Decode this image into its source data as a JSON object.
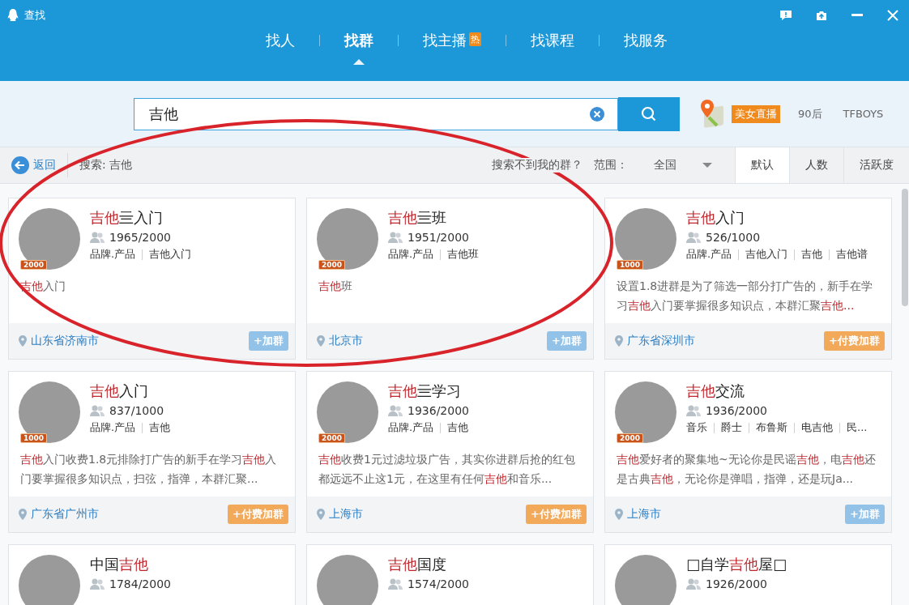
{
  "window": {
    "title": "查找"
  },
  "nav_tabs": [
    {
      "label": "找人",
      "selected": false
    },
    {
      "label": "找群",
      "selected": true
    },
    {
      "label": "找主播",
      "selected": false,
      "badge": "热"
    },
    {
      "label": "找课程",
      "selected": false
    },
    {
      "label": "找服务",
      "selected": false
    }
  ],
  "search": {
    "value": "吉他"
  },
  "hot_tags": [
    {
      "label": "美女直播",
      "kind": "highlight"
    },
    {
      "label": "90后",
      "kind": "plain"
    },
    {
      "label": "TFBOYS",
      "kind": "plain"
    }
  ],
  "filter_bar": {
    "back": "返回",
    "query": "搜索: 吉他",
    "help": "搜索不到我的群？",
    "range_label": "范围：",
    "range_value": "全国"
  },
  "sort_tabs": [
    {
      "label": "默认",
      "selected": true
    },
    {
      "label": "人数",
      "selected": false
    },
    {
      "label": "活跃度",
      "selected": false
    }
  ],
  "groups": [
    {
      "name": [
        {
          "text": "吉他",
          "highlight": true
        },
        {
          "text": "亖入门",
          "highlight": false
        }
      ],
      "tier": "2000",
      "members": "1965/2000",
      "tags": [
        "品牌.产品",
        "吉他入门"
      ],
      "description": [
        {
          "text": "吉他",
          "highlight": true
        },
        {
          "text": "入门",
          "highlight": false
        }
      ],
      "location": "山东省济南市",
      "button": {
        "label": "+加群",
        "kind": "free"
      }
    },
    {
      "name": [
        {
          "text": "吉他",
          "highlight": true
        },
        {
          "text": "亖班",
          "highlight": false
        }
      ],
      "tier": "2000",
      "members": "1951/2000",
      "tags": [
        "品牌.产品",
        "吉他班"
      ],
      "description": [
        {
          "text": "吉他",
          "highlight": true
        },
        {
          "text": "班",
          "highlight": false
        }
      ],
      "location": "北京市",
      "button": {
        "label": "+加群",
        "kind": "free"
      }
    },
    {
      "name": [
        {
          "text": "吉他",
          "highlight": true
        },
        {
          "text": "入门",
          "highlight": false
        }
      ],
      "tier": "1000",
      "members": "526/1000",
      "tags": [
        "品牌.产品",
        "吉他入门",
        "吉他",
        "吉他谱"
      ],
      "description": [
        {
          "text": "设置1.8进群是为了筛选一部分打广告的，新手在学习",
          "highlight": false
        },
        {
          "text": "吉他",
          "highlight": true
        },
        {
          "text": "入门要掌握很多知识点，本群汇聚",
          "highlight": false
        },
        {
          "text": "吉他...",
          "highlight": true
        }
      ],
      "location": "广东省深圳市",
      "button": {
        "label": "+付费加群",
        "kind": "paid"
      }
    },
    {
      "name": [
        {
          "text": "吉他",
          "highlight": true
        },
        {
          "text": "入门",
          "highlight": false
        }
      ],
      "tier": "1000",
      "members": "837/1000",
      "tags": [
        "品牌.产品",
        "吉他"
      ],
      "description": [
        {
          "text": "吉他",
          "highlight": true
        },
        {
          "text": "入门收费1.8元排除打广告的新手在学习",
          "highlight": false
        },
        {
          "text": "吉他",
          "highlight": true
        },
        {
          "text": "入门要掌握很多知识点，扫弦，指弹，本群汇聚...",
          "highlight": false
        }
      ],
      "location": "广东省广州市",
      "button": {
        "label": "+付费加群",
        "kind": "paid"
      }
    },
    {
      "name": [
        {
          "text": "吉他",
          "highlight": true
        },
        {
          "text": "亖学习",
          "highlight": false
        }
      ],
      "tier": "2000",
      "members": "1936/2000",
      "tags": [
        "品牌.产品",
        "吉他"
      ],
      "description": [
        {
          "text": "吉他",
          "highlight": true
        },
        {
          "text": "收费1元过滤垃圾广告，其实你进群后抢的红包都远远不止这1元，在这里有任何",
          "highlight": false
        },
        {
          "text": "吉他",
          "highlight": true
        },
        {
          "text": "和音乐...",
          "highlight": false
        }
      ],
      "location": "上海市",
      "button": {
        "label": "+付费加群",
        "kind": "paid"
      }
    },
    {
      "name": [
        {
          "text": "吉他",
          "highlight": true
        },
        {
          "text": "交流",
          "highlight": false
        }
      ],
      "tier": "2000",
      "members": "1936/2000",
      "tags": [
        "音乐",
        "爵士",
        "布鲁斯",
        "电吉他",
        "民..."
      ],
      "description": [
        {
          "text": "吉他",
          "highlight": true
        },
        {
          "text": "爱好者的聚集地~无论你是民谣",
          "highlight": false
        },
        {
          "text": "吉他",
          "highlight": true
        },
        {
          "text": "，电",
          "highlight": false
        },
        {
          "text": "吉他",
          "highlight": true
        },
        {
          "text": "还是古典",
          "highlight": false
        },
        {
          "text": "吉他",
          "highlight": true
        },
        {
          "text": "，无论你是弹唱，指弹，还是玩Ja...",
          "highlight": false
        }
      ],
      "location": "上海市",
      "button": {
        "label": "+加群",
        "kind": "free"
      }
    },
    {
      "name": [
        {
          "text": "中国",
          "highlight": false
        },
        {
          "text": "吉他",
          "highlight": true
        }
      ],
      "members": "1784/2000"
    },
    {
      "name": [
        {
          "text": "吉他",
          "highlight": true
        },
        {
          "text": "国度",
          "highlight": false
        }
      ],
      "members": "1574/2000"
    },
    {
      "name": [
        {
          "text": "□自学",
          "highlight": false
        },
        {
          "text": "吉他",
          "highlight": true
        },
        {
          "text": "屋□",
          "highlight": false
        }
      ],
      "members": "1926/2000"
    }
  ]
}
